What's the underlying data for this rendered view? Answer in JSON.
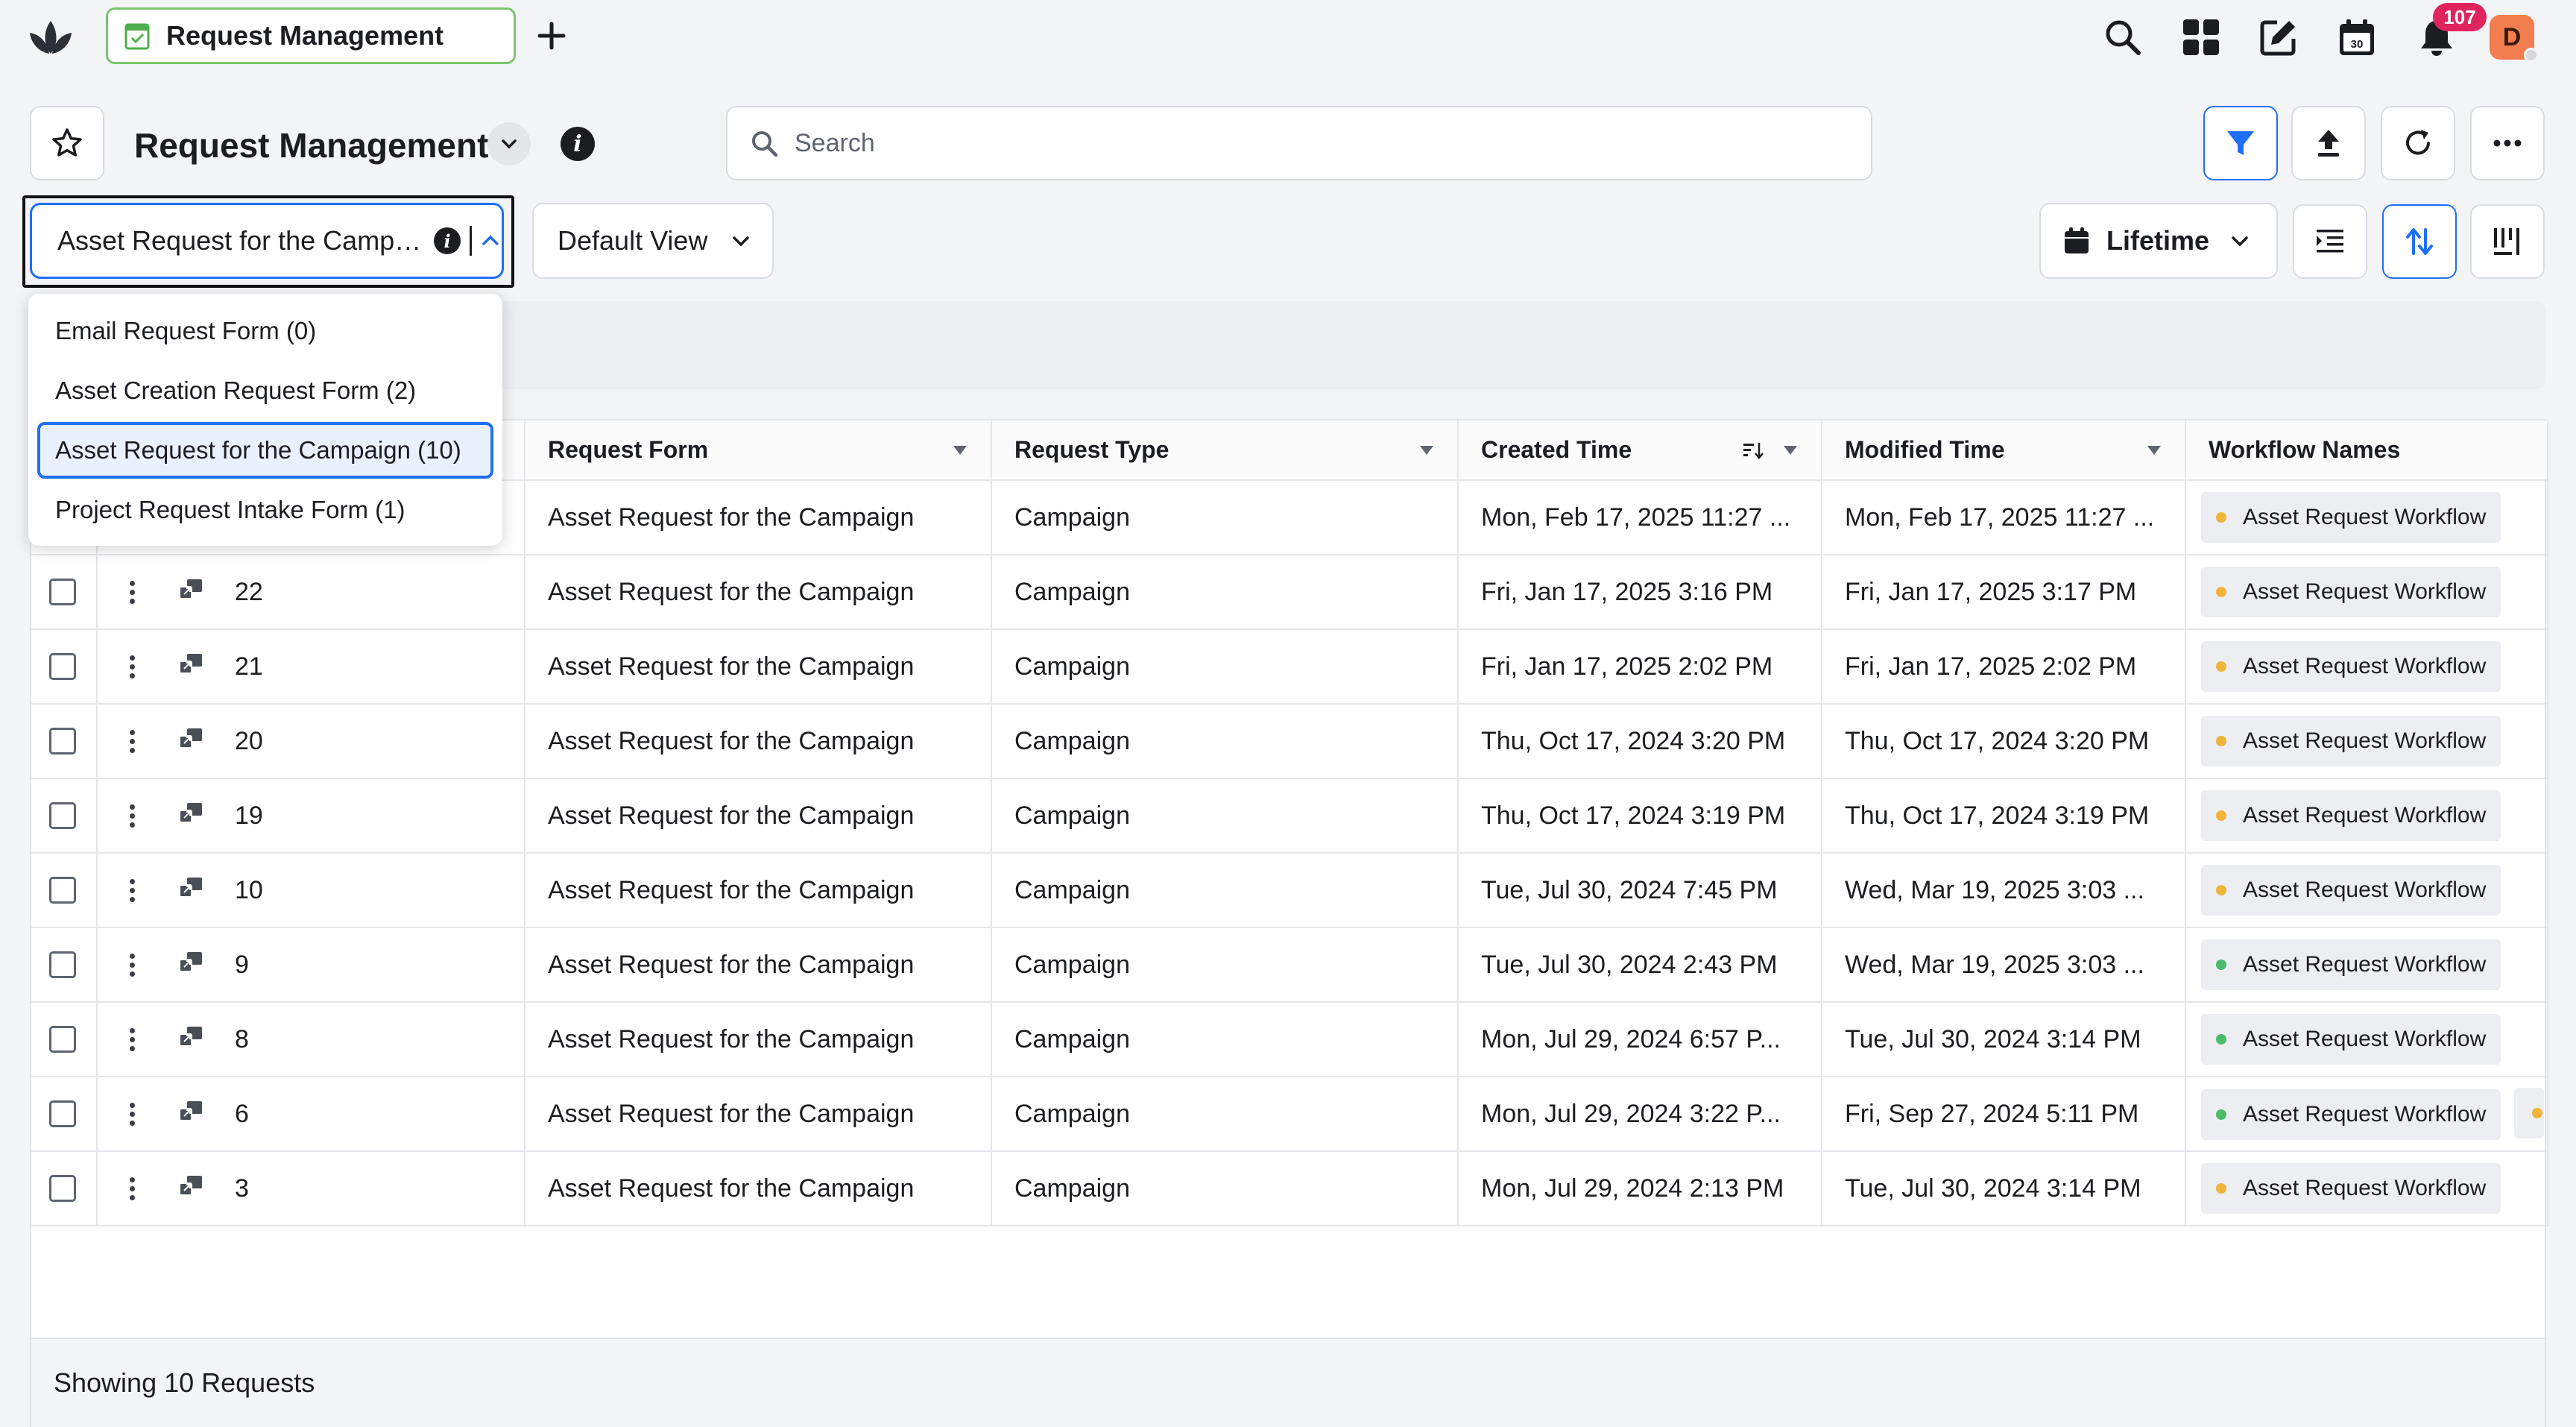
{
  "app": {
    "tab_label": "Request Management",
    "notification_count": "107",
    "avatar_initial": "D"
  },
  "header": {
    "title": "Request Management",
    "search_placeholder": "Search"
  },
  "toolbar": {
    "form_selected": "Asset Request for the Campaign",
    "view_selected": "Default View",
    "date_range": "Lifetime"
  },
  "dropdown": {
    "items": [
      {
        "label": "Email Request Form (0)"
      },
      {
        "label": "Asset Creation Request Form (2)"
      },
      {
        "label": "Asset Request for the Campaign (10)"
      },
      {
        "label": "Project Request Intake Form (1)"
      }
    ]
  },
  "table": {
    "headers": {
      "request_form": "Request Form",
      "request_type": "Request Type",
      "created_time": "Created Time",
      "modified_time": "Modified Time",
      "workflow_names": "Workflow Names"
    },
    "rows": [
      {
        "id": "",
        "form": "Asset Request for the Campaign",
        "type": "Campaign",
        "created": "Mon, Feb 17, 2025 11:27 ...",
        "modified": "Mon, Feb 17, 2025 11:27 ...",
        "workflow": "Asset Request Workflow",
        "status_color": "#f0b43c"
      },
      {
        "id": "22",
        "form": "Asset Request for the Campaign",
        "type": "Campaign",
        "created": "Fri, Jan 17, 2025 3:16 PM",
        "modified": "Fri, Jan 17, 2025 3:17 PM",
        "workflow": "Asset Request Workflow",
        "status_color": "#f0b43c"
      },
      {
        "id": "21",
        "form": "Asset Request for the Campaign",
        "type": "Campaign",
        "created": "Fri, Jan 17, 2025 2:02 PM",
        "modified": "Fri, Jan 17, 2025 2:02 PM",
        "workflow": "Asset Request Workflow",
        "status_color": "#f0b43c"
      },
      {
        "id": "20",
        "form": "Asset Request for the Campaign",
        "type": "Campaign",
        "created": "Thu, Oct 17, 2024 3:20 PM",
        "modified": "Thu, Oct 17, 2024 3:20 PM",
        "workflow": "Asset Request Workflow",
        "status_color": "#f0b43c"
      },
      {
        "id": "19",
        "form": "Asset Request for the Campaign",
        "type": "Campaign",
        "created": "Thu, Oct 17, 2024 3:19 PM",
        "modified": "Thu, Oct 17, 2024 3:19 PM",
        "workflow": "Asset Request Workflow",
        "status_color": "#f0b43c"
      },
      {
        "id": "10",
        "form": "Asset Request for the Campaign",
        "type": "Campaign",
        "created": "Tue, Jul 30, 2024 7:45 PM",
        "modified": "Wed, Mar 19, 2025 3:03 ...",
        "workflow": "Asset Request Workflow",
        "status_color": "#f0b43c"
      },
      {
        "id": "9",
        "form": "Asset Request for the Campaign",
        "type": "Campaign",
        "created": "Tue, Jul 30, 2024 2:43 PM",
        "modified": "Wed, Mar 19, 2025 3:03 ...",
        "workflow": "Asset Request Workflow",
        "status_color": "#4cbb6c"
      },
      {
        "id": "8",
        "form": "Asset Request for the Campaign",
        "type": "Campaign",
        "created": "Mon, Jul 29, 2024 6:57 P...",
        "modified": "Tue, Jul 30, 2024 3:14 PM",
        "workflow": "Asset Request Workflow",
        "status_color": "#4cbb6c"
      },
      {
        "id": "6",
        "form": "Asset Request for the Campaign",
        "type": "Campaign",
        "created": "Mon, Jul 29, 2024 3:22 P...",
        "modified": "Fri, Sep 27, 2024 5:11 PM",
        "workflow": "Asset Request Workflow",
        "status_color": "#4cbb6c"
      },
      {
        "id": "3",
        "form": "Asset Request for the Campaign",
        "type": "Campaign",
        "created": "Mon, Jul 29, 2024 2:13 PM",
        "modified": "Tue, Jul 30, 2024 3:14 PM",
        "workflow": "Asset Request Workflow",
        "status_color": "#f0b43c"
      }
    ]
  },
  "footer": {
    "summary": "Showing 10 Requests"
  },
  "colors": {
    "accent": "#1f6ff5",
    "tab_border": "#7cc46d",
    "badge": "#e0245e",
    "status_yellow": "#f0b43c",
    "status_green": "#4cbb6c"
  },
  "icons": [
    "sprinklr-logo-icon",
    "form-tab-icon",
    "plus-icon",
    "search-icon",
    "apps-grid-icon",
    "compose-icon",
    "calendar-icon",
    "bell-icon",
    "star-icon",
    "chevron-down-icon",
    "info-icon",
    "filter-icon",
    "upload-icon",
    "refresh-icon",
    "more-icon",
    "density-icon",
    "sort-icon",
    "columns-icon",
    "sort-desc-icon",
    "record-link-icon"
  ]
}
